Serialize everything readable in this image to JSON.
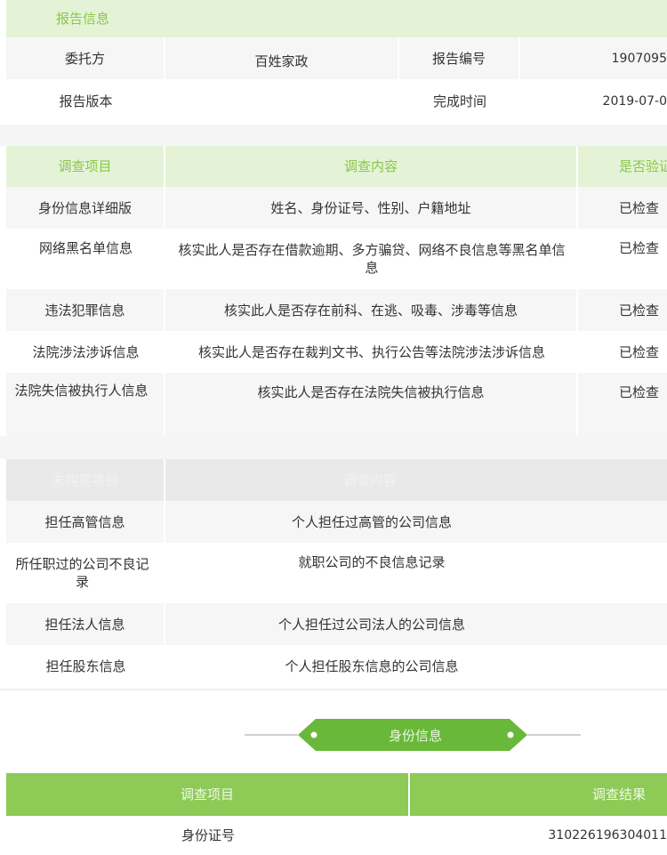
{
  "report_info": {
    "section_title": "报告信息",
    "client_label": "委托方",
    "client_value": "百姓家政",
    "report_no_label": "报告编号",
    "report_no_value": "1907095",
    "version_label": "报告版本",
    "version_value": "",
    "finish_time_label": "完成时间",
    "finish_time_value": "2019-07-0"
  },
  "survey_table": {
    "headers": [
      "调查项目",
      "调查内容",
      "是否验证"
    ],
    "rows": [
      {
        "item": "身份信息详细版",
        "content": "姓名、身份证号、性别、户籍地址",
        "status": "已检查"
      },
      {
        "item": "网络黑名单信息",
        "content": "核实此人是否存在借款逾期、多方骗贷、网络不良信息等黑名单信息",
        "status": "已检查"
      },
      {
        "item": "违法犯罪信息",
        "content": "核实此人是否存在前科、在逃、吸毒、涉毒等信息",
        "status": "已检查"
      },
      {
        "item": "法院涉法涉诉信息",
        "content": "核实此人是否存在裁判文书、执行公告等法院涉法涉诉信息",
        "status": "已检查"
      },
      {
        "item": "法院失信被执行人信息",
        "content": "核实此人是否存在法院失信被执行信息",
        "status": "已检查"
      }
    ]
  },
  "unpurchased_table": {
    "headers": [
      "未购买项目",
      "调查内容"
    ],
    "rows": [
      {
        "item": "担任高管信息",
        "content": "个人担任过高管的公司信息"
      },
      {
        "item": "所任职过的公司不良记录",
        "content": "就职公司的不良信息记录"
      },
      {
        "item": "担任法人信息",
        "content": "个人担任过公司法人的公司信息"
      },
      {
        "item": "担任股东信息",
        "content": "个人担任股东信息的公司信息"
      }
    ]
  },
  "identity_section": {
    "banner_title": "身份信息",
    "headers": [
      "调查项目",
      "调查结果"
    ],
    "rows": [
      {
        "item": "身份证号",
        "result": "310226196304011"
      }
    ]
  },
  "colors": {
    "accent_green": "#8dcb56",
    "light_green": "#e4f3d6",
    "banner_green": "#6ab83a",
    "header_gray": "#e9e9e9"
  }
}
